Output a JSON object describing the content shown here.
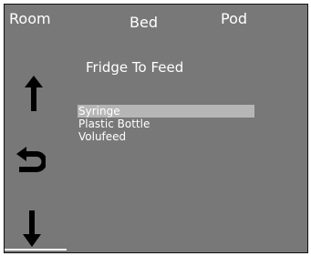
{
  "tabs": {
    "room": "Room",
    "bed": "Bed",
    "pod": "Pod"
  },
  "title": "Fridge To Feed",
  "items": [
    {
      "label": "Syringe",
      "selected": true
    },
    {
      "label": "Plastic Bottle",
      "selected": false
    },
    {
      "label": "Volufeed",
      "selected": false
    }
  ],
  "nav": {
    "up_icon": "arrow-up-icon",
    "back_icon": "return-arrow-icon",
    "down_icon": "arrow-down-icon"
  },
  "colors": {
    "screen_background": "#787878",
    "selection": "#b6b6b6",
    "text": "#ffffff",
    "icon": "#000000"
  }
}
